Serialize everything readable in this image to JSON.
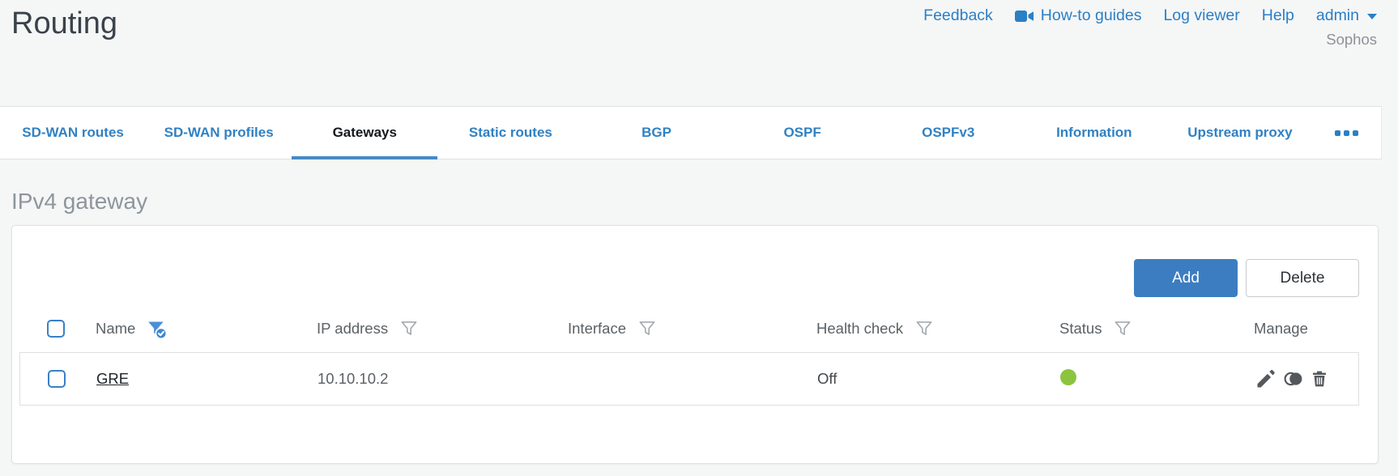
{
  "page": {
    "title": "Routing",
    "brand": "Sophos"
  },
  "header": {
    "links": {
      "feedback": "Feedback",
      "howto": "How-to guides",
      "log_viewer": "Log viewer",
      "help": "Help",
      "user": "admin"
    }
  },
  "tabs": {
    "items": [
      {
        "label": "SD-WAN routes",
        "active": false
      },
      {
        "label": "SD-WAN profiles",
        "active": false
      },
      {
        "label": "Gateways",
        "active": true
      },
      {
        "label": "Static routes",
        "active": false
      },
      {
        "label": "BGP",
        "active": false
      },
      {
        "label": "OSPF",
        "active": false
      },
      {
        "label": "OSPFv3",
        "active": false
      },
      {
        "label": "Information",
        "active": false
      },
      {
        "label": "Upstream proxy",
        "active": false
      }
    ]
  },
  "section": {
    "heading": "IPv4 gateway"
  },
  "toolbar": {
    "add": "Add",
    "delete": "Delete"
  },
  "table": {
    "columns": [
      {
        "label": "Name",
        "filter": "active"
      },
      {
        "label": "IP address",
        "filter": "inactive"
      },
      {
        "label": "Interface",
        "filter": "inactive"
      },
      {
        "label": "Health check",
        "filter": "inactive"
      },
      {
        "label": "Status",
        "filter": "inactive"
      },
      {
        "label": "Manage",
        "filter": "none"
      }
    ],
    "rows": [
      {
        "name": "GRE",
        "ip_address": "10.10.10.2",
        "interface": "",
        "health_check": "Off",
        "status": "up",
        "status_color": "#8bc53f"
      }
    ]
  },
  "colors": {
    "accent_blue": "#2b7fc6",
    "add_button_blue": "#3c7dc1",
    "active_tab_underline": "#4789c6",
    "status_green": "#8bc53f"
  }
}
